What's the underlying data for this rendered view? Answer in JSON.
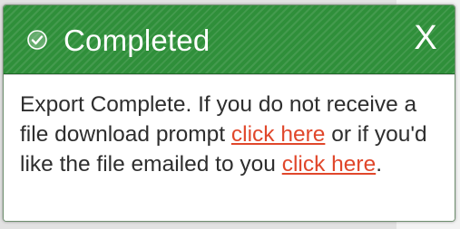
{
  "dialog": {
    "title": "Completed",
    "close_label": "X",
    "icons": {
      "status": "check-circle-icon"
    },
    "colors": {
      "titlebar": "#2f8f3a",
      "link": "#e0472b",
      "text": "#2e2e2e"
    },
    "message": {
      "part1": "Export Complete. If you do not receive a file download prompt",
      "link1": "click here",
      "part2": "or if you'd like the file emailed to you",
      "link2": "click here",
      "end": "."
    }
  }
}
